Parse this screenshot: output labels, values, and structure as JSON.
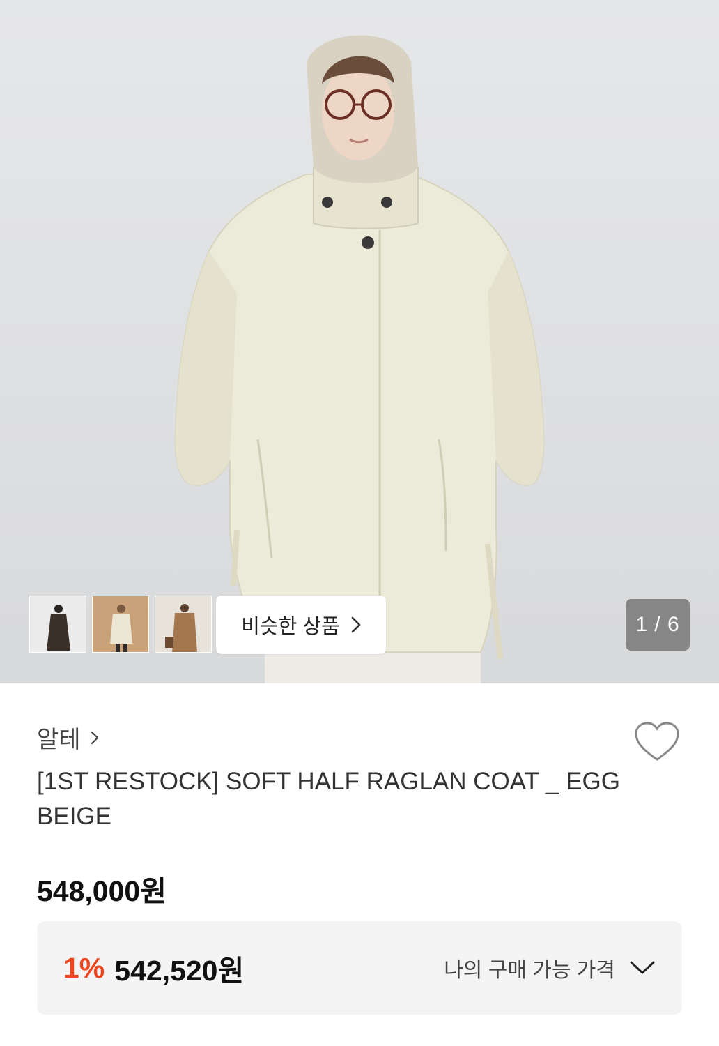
{
  "gallery": {
    "counter": "1 / 6",
    "similar_label": "비슷한 상품",
    "thumbnails": [
      "dark-coat-thumb",
      "beige-coat-thumb",
      "camel-coat-thumb"
    ]
  },
  "product": {
    "brand": "알테",
    "title": "[1ST RESTOCK] SOFT HALF RAGLAN COAT _ EGG BEIGE",
    "price": "548,000원"
  },
  "my_price": {
    "rate": "1%",
    "amount": "542,520원",
    "label": "나의 구매 가능 가격"
  },
  "colors": {
    "accent": "#f0461e",
    "background": "#ffffff",
    "panel": "#f4f4f4"
  },
  "icons": {
    "wish": "heart-icon",
    "brand": "chevron-right-icon",
    "expand": "chevron-down-icon"
  }
}
